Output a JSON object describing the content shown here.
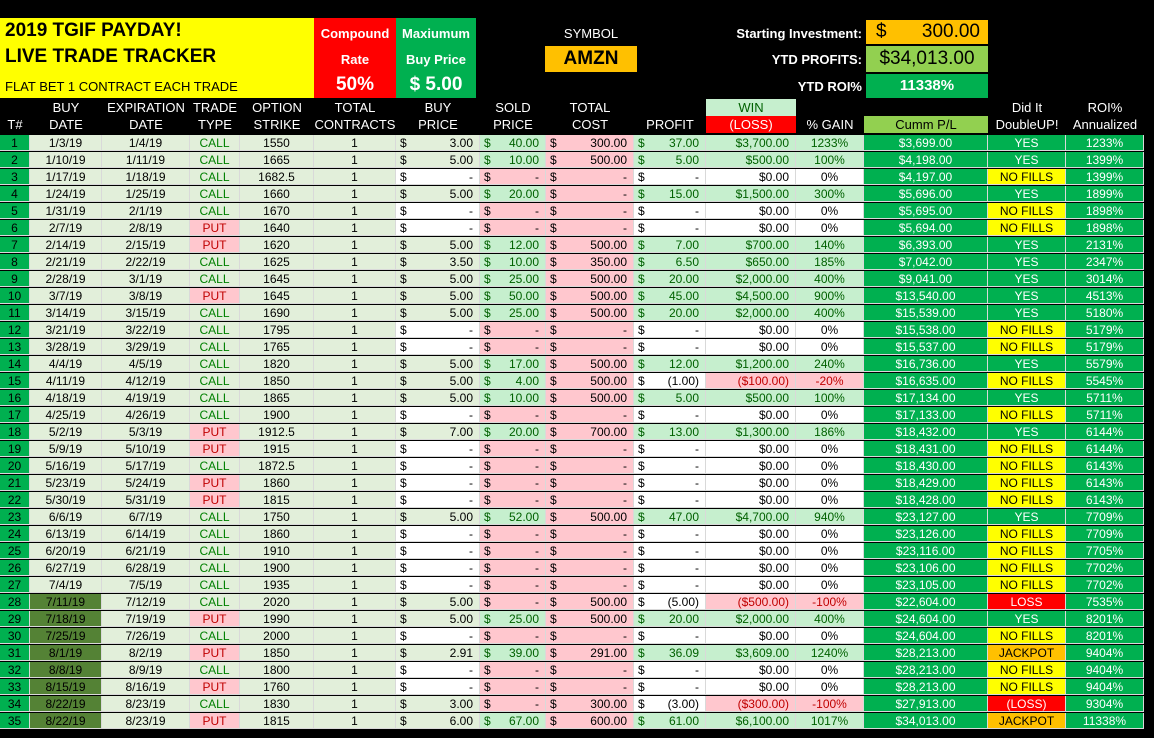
{
  "header": {
    "title_line1": "2019 TGIF PAYDAY!",
    "title_line2": "LIVE TRADE TRACKER",
    "title_line3": "FLAT BET 1 CONTRACT EACH TRADE",
    "compound_label1": "Compound",
    "compound_label2": "Rate",
    "compound_value": "50%",
    "max_label1": "Maxiumum",
    "max_label2": "Buy Price",
    "max_value": "$  5.00",
    "symbol_label": "SYMBOL",
    "symbol_value": "AMZN",
    "starting_label": "Starting Investment:",
    "starting_dollar": "$",
    "starting_value": "300.00",
    "ytd_profits_label": "YTD PROFITS:",
    "ytd_profits_value": "$34,013.00",
    "ytd_roi_label": "YTD ROI%",
    "ytd_roi_value": "11338%"
  },
  "columns": [
    {
      "l1": "",
      "l2": "T#"
    },
    {
      "l1": "BUY",
      "l2": "DATE"
    },
    {
      "l1": "EXPIRATION",
      "l2": "DATE"
    },
    {
      "l1": "TRADE",
      "l2": "TYPE"
    },
    {
      "l1": "OPTION",
      "l2": "STRIKE"
    },
    {
      "l1": "TOTAL",
      "l2": "CONTRACTS"
    },
    {
      "l1": "BUY",
      "l2": "PRICE"
    },
    {
      "l1": "SOLD",
      "l2": "PRICE"
    },
    {
      "l1": "TOTAL",
      "l2": "COST"
    },
    {
      "l1": "",
      "l2": "PROFIT"
    },
    {
      "l1": "WIN",
      "l2": "(LOSS)"
    },
    {
      "l1": "",
      "l2": "% GAIN"
    },
    {
      "l1": "",
      "l2": "Cumm P/L"
    },
    {
      "l1": "Did It",
      "l2": "DoubleUP!"
    },
    {
      "l1": "ROI%",
      "l2": "Annualized"
    }
  ],
  "rows": [
    {
      "n": "1",
      "buy_date": "1/3/19",
      "exp_date": "1/4/19",
      "type": "CALL",
      "strike": "1550",
      "contracts": "1",
      "buy_price": "3.00",
      "sold_price": "40.00",
      "cost": "300.00",
      "profit": "37.00",
      "win": "$3,700.00",
      "gain": "1233%",
      "cumm": "$3,699.00",
      "dbl": "YES",
      "roi": "1233%"
    },
    {
      "n": "2",
      "buy_date": "1/10/19",
      "exp_date": "1/11/19",
      "type": "CALL",
      "strike": "1665",
      "contracts": "1",
      "buy_price": "5.00",
      "sold_price": "10.00",
      "cost": "500.00",
      "profit": "5.00",
      "win": "$500.00",
      "gain": "100%",
      "cumm": "$4,198.00",
      "dbl": "YES",
      "roi": "1399%"
    },
    {
      "n": "3",
      "buy_date": "1/17/19",
      "exp_date": "1/18/19",
      "type": "CALL",
      "strike": "1682.5",
      "contracts": "1",
      "buy_price": "-",
      "sold_price": "-",
      "cost": "-",
      "profit": "-",
      "win": "$0.00",
      "gain": "0%",
      "cumm": "$4,197.00",
      "dbl": "NO FILLS",
      "roi": "1399%"
    },
    {
      "n": "4",
      "buy_date": "1/24/19",
      "exp_date": "1/25/19",
      "type": "CALL",
      "strike": "1660",
      "contracts": "1",
      "buy_price": "5.00",
      "sold_price": "20.00",
      "cost": "-",
      "profit": "15.00",
      "win": "$1,500.00",
      "gain": "300%",
      "cumm": "$5,696.00",
      "dbl": "YES",
      "roi": "1899%"
    },
    {
      "n": "5",
      "buy_date": "1/31/19",
      "exp_date": "2/1/19",
      "type": "CALL",
      "strike": "1670",
      "contracts": "1",
      "buy_price": "-",
      "sold_price": "-",
      "cost": "-",
      "profit": "-",
      "win": "$0.00",
      "gain": "0%",
      "cumm": "$5,695.00",
      "dbl": "NO FILLS",
      "roi": "1898%"
    },
    {
      "n": "6",
      "buy_date": "2/7/19",
      "exp_date": "2/8/19",
      "type": "PUT",
      "strike": "1640",
      "contracts": "1",
      "buy_price": "-",
      "sold_price": "-",
      "cost": "-",
      "profit": "-",
      "win": "$0.00",
      "gain": "0%",
      "cumm": "$5,694.00",
      "dbl": "NO FILLS",
      "roi": "1898%"
    },
    {
      "n": "7",
      "buy_date": "2/14/19",
      "exp_date": "2/15/19",
      "type": "PUT",
      "strike": "1620",
      "contracts": "1",
      "buy_price": "5.00",
      "sold_price": "12.00",
      "cost": "500.00",
      "profit": "7.00",
      "win": "$700.00",
      "gain": "140%",
      "cumm": "$6,393.00",
      "dbl": "YES",
      "roi": "2131%"
    },
    {
      "n": "8",
      "buy_date": "2/21/19",
      "exp_date": "2/22/19",
      "type": "CALL",
      "strike": "1625",
      "contracts": "1",
      "buy_price": "3.50",
      "sold_price": "10.00",
      "cost": "350.00",
      "profit": "6.50",
      "win": "$650.00",
      "gain": "185%",
      "cumm": "$7,042.00",
      "dbl": "YES",
      "roi": "2347%"
    },
    {
      "n": "9",
      "buy_date": "2/28/19",
      "exp_date": "3/1/19",
      "type": "CALL",
      "strike": "1645",
      "contracts": "1",
      "buy_price": "5.00",
      "sold_price": "25.00",
      "cost": "500.00",
      "profit": "20.00",
      "win": "$2,000.00",
      "gain": "400%",
      "cumm": "$9,041.00",
      "dbl": "YES",
      "roi": "3014%"
    },
    {
      "n": "10",
      "buy_date": "3/7/19",
      "exp_date": "3/8/19",
      "type": "PUT",
      "strike": "1645",
      "contracts": "1",
      "buy_price": "5.00",
      "sold_price": "50.00",
      "cost": "500.00",
      "profit": "45.00",
      "win": "$4,500.00",
      "gain": "900%",
      "cumm": "$13,540.00",
      "dbl": "YES",
      "roi": "4513%"
    },
    {
      "n": "11",
      "buy_date": "3/14/19",
      "exp_date": "3/15/19",
      "type": "CALL",
      "strike": "1690",
      "contracts": "1",
      "buy_price": "5.00",
      "sold_price": "25.00",
      "cost": "500.00",
      "profit": "20.00",
      "win": "$2,000.00",
      "gain": "400%",
      "cumm": "$15,539.00",
      "dbl": "YES",
      "roi": "5180%"
    },
    {
      "n": "12",
      "buy_date": "3/21/19",
      "exp_date": "3/22/19",
      "type": "CALL",
      "strike": "1795",
      "contracts": "1",
      "buy_price": "-",
      "sold_price": "-",
      "cost": "-",
      "profit": "-",
      "win": "$0.00",
      "gain": "0%",
      "cumm": "$15,538.00",
      "dbl": "NO FILLS",
      "roi": "5179%"
    },
    {
      "n": "13",
      "buy_date": "3/28/19",
      "exp_date": "3/29/19",
      "type": "CALL",
      "strike": "1765",
      "contracts": "1",
      "buy_price": "-",
      "sold_price": "-",
      "cost": "-",
      "profit": "-",
      "win": "$0.00",
      "gain": "0%",
      "cumm": "$15,537.00",
      "dbl": "NO FILLS",
      "roi": "5179%"
    },
    {
      "n": "14",
      "buy_date": "4/4/19",
      "exp_date": "4/5/19",
      "type": "CALL",
      "strike": "1820",
      "contracts": "1",
      "buy_price": "5.00",
      "sold_price": "17.00",
      "cost": "500.00",
      "profit": "12.00",
      "win": "$1,200.00",
      "gain": "240%",
      "cumm": "$16,736.00",
      "dbl": "YES",
      "roi": "5579%"
    },
    {
      "n": "15",
      "buy_date": "4/11/19",
      "exp_date": "4/12/19",
      "type": "CALL",
      "strike": "1850",
      "contracts": "1",
      "buy_price": "5.00",
      "sold_price": "4.00",
      "cost": "500.00",
      "profit": "(1.00)",
      "win": "($100.00)",
      "gain": "-20%",
      "cumm": "$16,635.00",
      "dbl": "NO FILLS",
      "roi": "5545%"
    },
    {
      "n": "16",
      "buy_date": "4/18/19",
      "exp_date": "4/19/19",
      "type": "CALL",
      "strike": "1865",
      "contracts": "1",
      "buy_price": "5.00",
      "sold_price": "10.00",
      "cost": "500.00",
      "profit": "5.00",
      "win": "$500.00",
      "gain": "100%",
      "cumm": "$17,134.00",
      "dbl": "YES",
      "roi": "5711%"
    },
    {
      "n": "17",
      "buy_date": "4/25/19",
      "exp_date": "4/26/19",
      "type": "CALL",
      "strike": "1900",
      "contracts": "1",
      "buy_price": "-",
      "sold_price": "-",
      "cost": "-",
      "profit": "-",
      "win": "$0.00",
      "gain": "0%",
      "cumm": "$17,133.00",
      "dbl": "NO FILLS",
      "roi": "5711%"
    },
    {
      "n": "18",
      "buy_date": "5/2/19",
      "exp_date": "5/3/19",
      "type": "PUT",
      "strike": "1912.5",
      "contracts": "1",
      "buy_price": "7.00",
      "sold_price": "20.00",
      "cost": "700.00",
      "profit": "13.00",
      "win": "$1,300.00",
      "gain": "186%",
      "cumm": "$18,432.00",
      "dbl": "YES",
      "roi": "6144%"
    },
    {
      "n": "19",
      "buy_date": "5/9/19",
      "exp_date": "5/10/19",
      "type": "PUT",
      "strike": "1915",
      "contracts": "1",
      "buy_price": "-",
      "sold_price": "-",
      "cost": "-",
      "profit": "-",
      "win": "$0.00",
      "gain": "0%",
      "cumm": "$18,431.00",
      "dbl": "NO FILLS",
      "roi": "6144%"
    },
    {
      "n": "20",
      "buy_date": "5/16/19",
      "exp_date": "5/17/19",
      "type": "CALL",
      "strike": "1872.5",
      "contracts": "1",
      "buy_price": "-",
      "sold_price": "-",
      "cost": "-",
      "profit": "-",
      "win": "$0.00",
      "gain": "0%",
      "cumm": "$18,430.00",
      "dbl": "NO FILLS",
      "roi": "6143%"
    },
    {
      "n": "21",
      "buy_date": "5/23/19",
      "exp_date": "5/24/19",
      "type": "PUT",
      "strike": "1860",
      "contracts": "1",
      "buy_price": "-",
      "sold_price": "-",
      "cost": "-",
      "profit": "-",
      "win": "$0.00",
      "gain": "0%",
      "cumm": "$18,429.00",
      "dbl": "NO FILLS",
      "roi": "6143%"
    },
    {
      "n": "22",
      "buy_date": "5/30/19",
      "exp_date": "5/31/19",
      "type": "PUT",
      "strike": "1815",
      "contracts": "1",
      "buy_price": "-",
      "sold_price": "-",
      "cost": "-",
      "profit": "-",
      "win": "$0.00",
      "gain": "0%",
      "cumm": "$18,428.00",
      "dbl": "NO FILLS",
      "roi": "6143%"
    },
    {
      "n": "23",
      "buy_date": "6/6/19",
      "exp_date": "6/7/19",
      "type": "CALL",
      "strike": "1750",
      "contracts": "1",
      "buy_price": "5.00",
      "sold_price": "52.00",
      "cost": "500.00",
      "profit": "47.00",
      "win": "$4,700.00",
      "gain": "940%",
      "cumm": "$23,127.00",
      "dbl": "YES",
      "roi": "7709%"
    },
    {
      "n": "24",
      "buy_date": "6/13/19",
      "exp_date": "6/14/19",
      "type": "CALL",
      "strike": "1860",
      "contracts": "1",
      "buy_price": "-",
      "sold_price": "-",
      "cost": "-",
      "profit": "-",
      "win": "$0.00",
      "gain": "0%",
      "cumm": "$23,126.00",
      "dbl": "NO FILLS",
      "roi": "7709%"
    },
    {
      "n": "25",
      "buy_date": "6/20/19",
      "exp_date": "6/21/19",
      "type": "CALL",
      "strike": "1910",
      "contracts": "1",
      "buy_price": "-",
      "sold_price": "-",
      "cost": "-",
      "profit": "-",
      "win": "$0.00",
      "gain": "0%",
      "cumm": "$23,116.00",
      "dbl": "NO FILLS",
      "roi": "7705%"
    },
    {
      "n": "26",
      "buy_date": "6/27/19",
      "exp_date": "6/28/19",
      "type": "CALL",
      "strike": "1900",
      "contracts": "1",
      "buy_price": "-",
      "sold_price": "-",
      "cost": "-",
      "profit": "-",
      "win": "$0.00",
      "gain": "0%",
      "cumm": "$23,106.00",
      "dbl": "NO FILLS",
      "roi": "7702%"
    },
    {
      "n": "27",
      "buy_date": "7/4/19",
      "exp_date": "7/5/19",
      "type": "CALL",
      "strike": "1935",
      "contracts": "1",
      "buy_price": "-",
      "sold_price": "-",
      "cost": "-",
      "profit": "-",
      "win": "$0.00",
      "gain": "0%",
      "cumm": "$23,105.00",
      "dbl": "NO FILLS",
      "roi": "7702%"
    },
    {
      "n": "28",
      "buy_date": "7/11/19",
      "exp_date": "7/12/19",
      "type": "CALL",
      "strike": "2020",
      "contracts": "1",
      "buy_price": "5.00",
      "sold_price": "-",
      "cost": "500.00",
      "profit": "(5.00)",
      "win": "($500.00)",
      "gain": "-100%",
      "cumm": "$22,604.00",
      "dbl": "LOSS",
      "roi": "7535%"
    },
    {
      "n": "29",
      "buy_date": "7/18/19",
      "exp_date": "7/19/19",
      "type": "PUT",
      "strike": "1990",
      "contracts": "1",
      "buy_price": "5.00",
      "sold_price": "25.00",
      "cost": "500.00",
      "profit": "20.00",
      "win": "$2,000.00",
      "gain": "400%",
      "cumm": "$24,604.00",
      "dbl": "YES",
      "roi": "8201%"
    },
    {
      "n": "30",
      "buy_date": "7/25/19",
      "exp_date": "7/26/19",
      "type": "CALL",
      "strike": "2000",
      "contracts": "1",
      "buy_price": "-",
      "sold_price": "-",
      "cost": "-",
      "profit": "-",
      "win": "$0.00",
      "gain": "0%",
      "cumm": "$24,604.00",
      "dbl": "NO FILLS",
      "roi": "8201%"
    },
    {
      "n": "31",
      "buy_date": "8/1/19",
      "exp_date": "8/2/19",
      "type": "PUT",
      "strike": "1850",
      "contracts": "1",
      "buy_price": "2.91",
      "sold_price": "39.00",
      "cost": "291.00",
      "profit": "36.09",
      "win": "$3,609.00",
      "gain": "1240%",
      "cumm": "$28,213.00",
      "dbl": "JACKPOT",
      "roi": "9404%"
    },
    {
      "n": "32",
      "buy_date": "8/8/19",
      "exp_date": "8/9/19",
      "type": "CALL",
      "strike": "1800",
      "contracts": "1",
      "buy_price": "-",
      "sold_price": "-",
      "cost": "-",
      "profit": "-",
      "win": "$0.00",
      "gain": "0%",
      "cumm": "$28,213.00",
      "dbl": "NO FILLS",
      "roi": "9404%"
    },
    {
      "n": "33",
      "buy_date": "8/15/19",
      "exp_date": "8/16/19",
      "type": "PUT",
      "strike": "1760",
      "contracts": "1",
      "buy_price": "-",
      "sold_price": "-",
      "cost": "-",
      "profit": "-",
      "win": "$0.00",
      "gain": "0%",
      "cumm": "$28,213.00",
      "dbl": "NO FILLS",
      "roi": "9404%"
    },
    {
      "n": "34",
      "buy_date": "8/22/19",
      "exp_date": "8/23/19",
      "type": "CALL",
      "strike": "1830",
      "contracts": "1",
      "buy_price": "3.00",
      "sold_price": "-",
      "cost": "300.00",
      "profit": "(3.00)",
      "win": "($300.00)",
      "gain": "-100%",
      "cumm": "$27,913.00",
      "dbl": "(LOSS)",
      "roi": "9304%"
    },
    {
      "n": "35",
      "buy_date": "8/22/19",
      "exp_date": "8/23/19",
      "type": "PUT",
      "strike": "1815",
      "contracts": "1",
      "buy_price": "6.00",
      "sold_price": "67.00",
      "cost": "600.00",
      "profit": "61.00",
      "win": "$6,100.00",
      "gain": "1017%",
      "cumm": "$34,013.00",
      "dbl": "JACKPOT",
      "roi": "11338%"
    }
  ]
}
